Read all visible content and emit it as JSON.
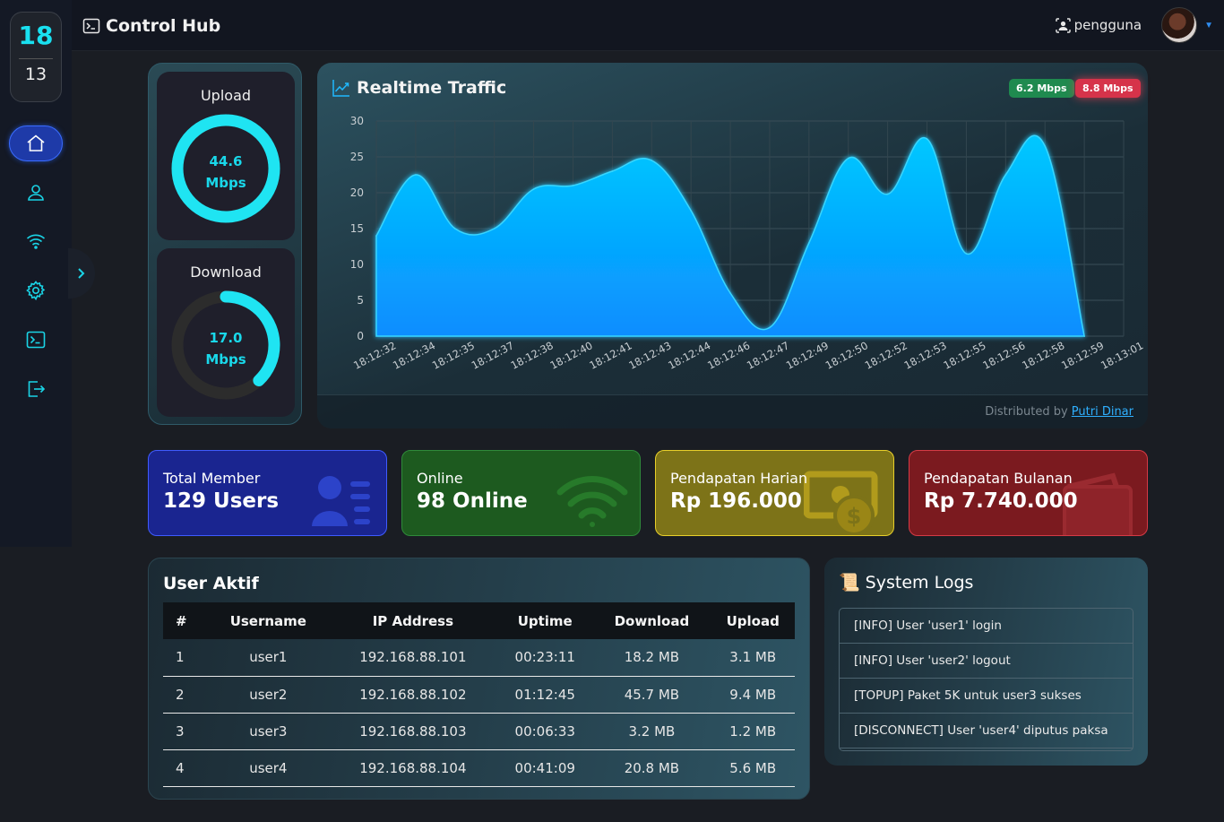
{
  "app": {
    "title": "Control Hub"
  },
  "user": {
    "name": "pengguna"
  },
  "clock": {
    "hour": "18",
    "minute": "13"
  },
  "sidebar": {
    "items": [
      {
        "name": "home",
        "active": true
      },
      {
        "name": "user"
      },
      {
        "name": "wifi"
      },
      {
        "name": "settings"
      },
      {
        "name": "terminal"
      },
      {
        "name": "logout"
      }
    ]
  },
  "speed": {
    "upload": {
      "label": "Upload",
      "value": "44.6",
      "unit": "Mbps",
      "fraction": 1.0
    },
    "download": {
      "label": "Download",
      "value": "17.0",
      "unit": "Mbps",
      "fraction": 0.38
    }
  },
  "traffic": {
    "title": "Realtime Traffic",
    "badge_upload": "6.2 Mbps",
    "badge_download": "8.8 Mbps",
    "footer_prefix": "Distributed by ",
    "footer_link": "Putri Dinar",
    "colors": {
      "fill": "#00b4ff",
      "badge_green": "#1f8a4f",
      "badge_red": "#d6334a"
    }
  },
  "chart_data": {
    "type": "area",
    "x": [
      "18:12:32",
      "18:12:34",
      "18:12:35",
      "18:12:37",
      "18:12:38",
      "18:12:40",
      "18:12:41",
      "18:12:43",
      "18:12:44",
      "18:12:46",
      "18:12:47",
      "18:12:49",
      "18:12:50",
      "18:12:52",
      "18:12:53",
      "18:12:55",
      "18:12:56",
      "18:12:58",
      "18:12:59",
      "18:13:01"
    ],
    "series": [
      {
        "values": [
          14,
          22.5,
          15,
          15,
          20.5,
          21,
          23,
          24.5,
          17.5,
          6,
          1.2,
          13,
          24.8,
          19.8,
          27.5,
          11.5,
          22.5,
          26.5,
          0,
          null
        ]
      }
    ],
    "ylim": [
      0,
      30
    ],
    "yticks": [
      0,
      5,
      10,
      15,
      20,
      25,
      30
    ],
    "grid": true
  },
  "stats": [
    {
      "label": "Total Member",
      "value": "129 Users",
      "icon": "users-icon"
    },
    {
      "label": "Online",
      "value": "98 Online",
      "icon": "wifi-icon"
    },
    {
      "label": "Pendapatan Harian",
      "value": "Rp 196.000",
      "icon": "money-icon"
    },
    {
      "label": "Pendapatan Bulanan",
      "value": "Rp 7.740.000",
      "icon": "wallet-icon"
    }
  ],
  "active_users": {
    "title": "User Aktif",
    "columns": [
      "#",
      "Username",
      "IP Address",
      "Uptime",
      "Download",
      "Upload"
    ],
    "rows": [
      [
        "1",
        "user1",
        "192.168.88.101",
        "00:23:11",
        "18.2 MB",
        "3.1 MB"
      ],
      [
        "2",
        "user2",
        "192.168.88.102",
        "01:12:45",
        "45.7 MB",
        "9.4 MB"
      ],
      [
        "3",
        "user3",
        "192.168.88.103",
        "00:06:33",
        "3.2 MB",
        "1.2 MB"
      ],
      [
        "4",
        "user4",
        "192.168.88.104",
        "00:41:09",
        "20.8 MB",
        "5.6 MB"
      ]
    ]
  },
  "logs": {
    "title": "System Logs",
    "icon": "📜",
    "items": [
      "[INFO] User 'user1' login",
      "[INFO] User 'user2' logout",
      "[TOPUP] Paket 5K untuk user3 sukses",
      "[DISCONNECT] User 'user4' diputus paksa"
    ]
  }
}
